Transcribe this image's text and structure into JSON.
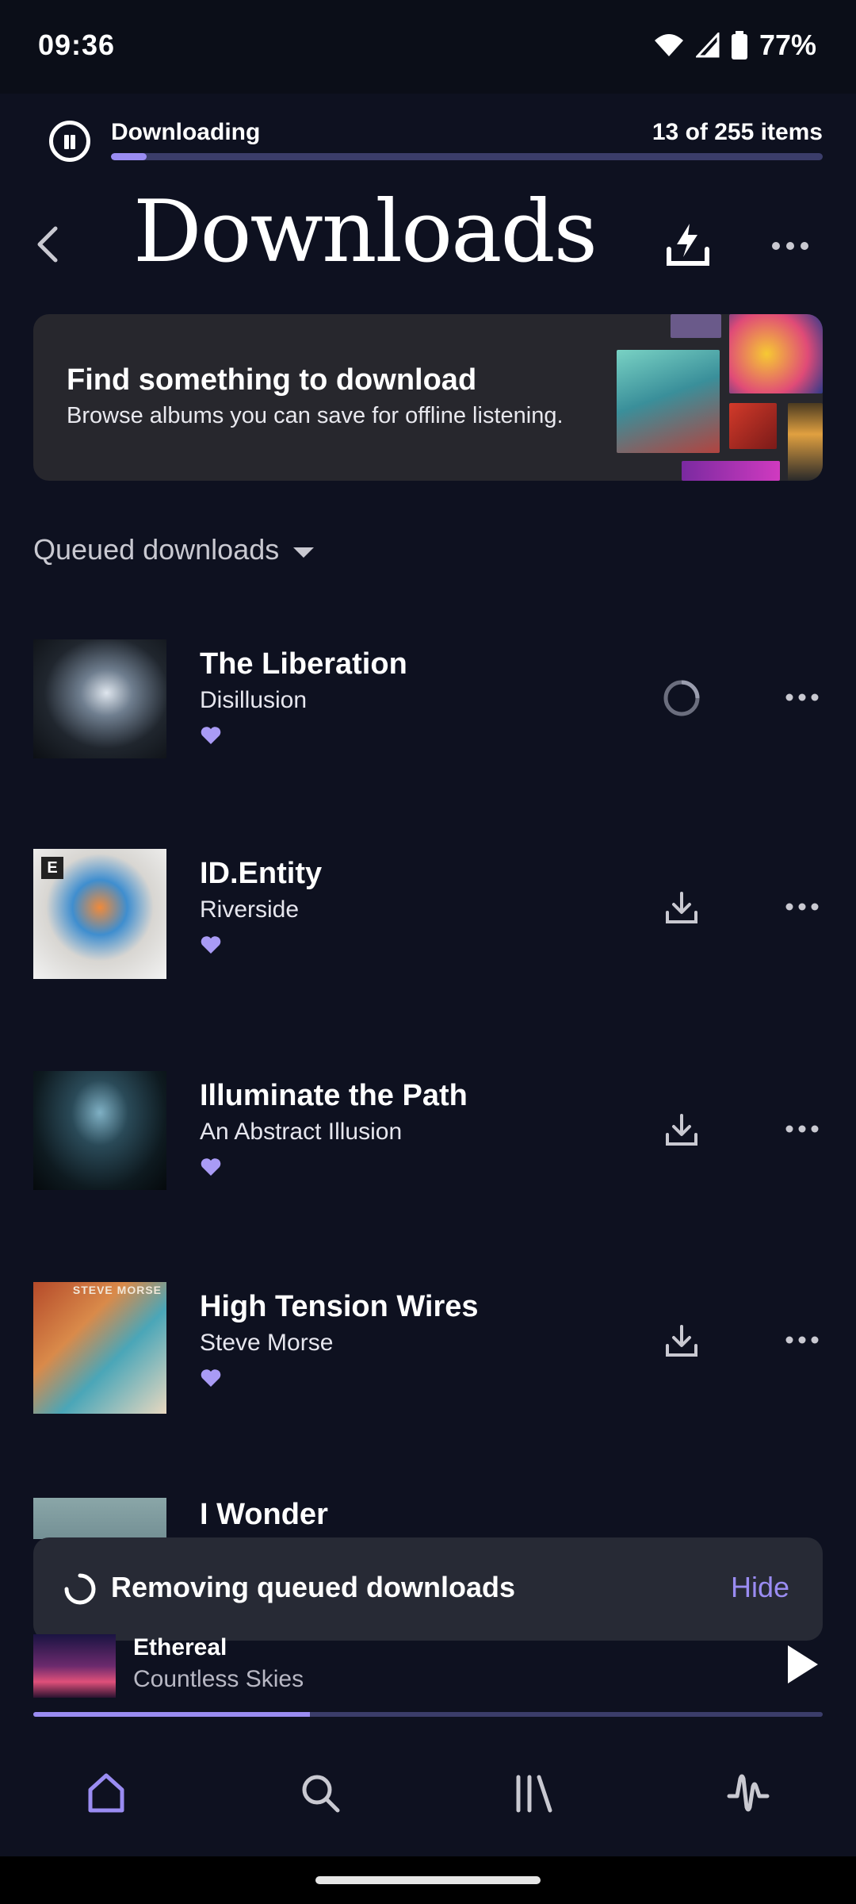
{
  "status_bar": {
    "time": "09:36",
    "battery": "77%"
  },
  "download_progress": {
    "label": "Downloading",
    "count_text": "13 of 255 items",
    "progress": 0.05
  },
  "header": {
    "title": "Downloads"
  },
  "banner": {
    "title": "Find something to download",
    "subtitle": "Browse albums you can save for offline listening."
  },
  "section": {
    "label": "Queued downloads"
  },
  "items": [
    {
      "title": "The Liberation",
      "artist": "Disillusion",
      "status": "downloading"
    },
    {
      "title": "ID.Entity",
      "artist": "Riverside",
      "status": "queued",
      "explicit": "E"
    },
    {
      "title": "Illuminate the Path",
      "artist": "An Abstract Illusion",
      "status": "queued"
    },
    {
      "title": "High Tension Wires",
      "artist": "Steve Morse",
      "status": "queued",
      "cover_text": "STEVE MORSE"
    },
    {
      "title": "I Wonder",
      "artist": "",
      "status": "queued"
    }
  ],
  "toast": {
    "text": "Removing queued downloads",
    "action": "Hide"
  },
  "mini_player": {
    "title": "Ethereal",
    "artist": "Countless Skies",
    "progress": 0.35
  },
  "nav": {
    "items": [
      "home-icon",
      "search-icon",
      "library-icon",
      "activity-icon"
    ]
  },
  "colors": {
    "accent": "#9a8cf2",
    "background": "#0e1120",
    "card": "#27272d",
    "toast": "#272a35"
  }
}
